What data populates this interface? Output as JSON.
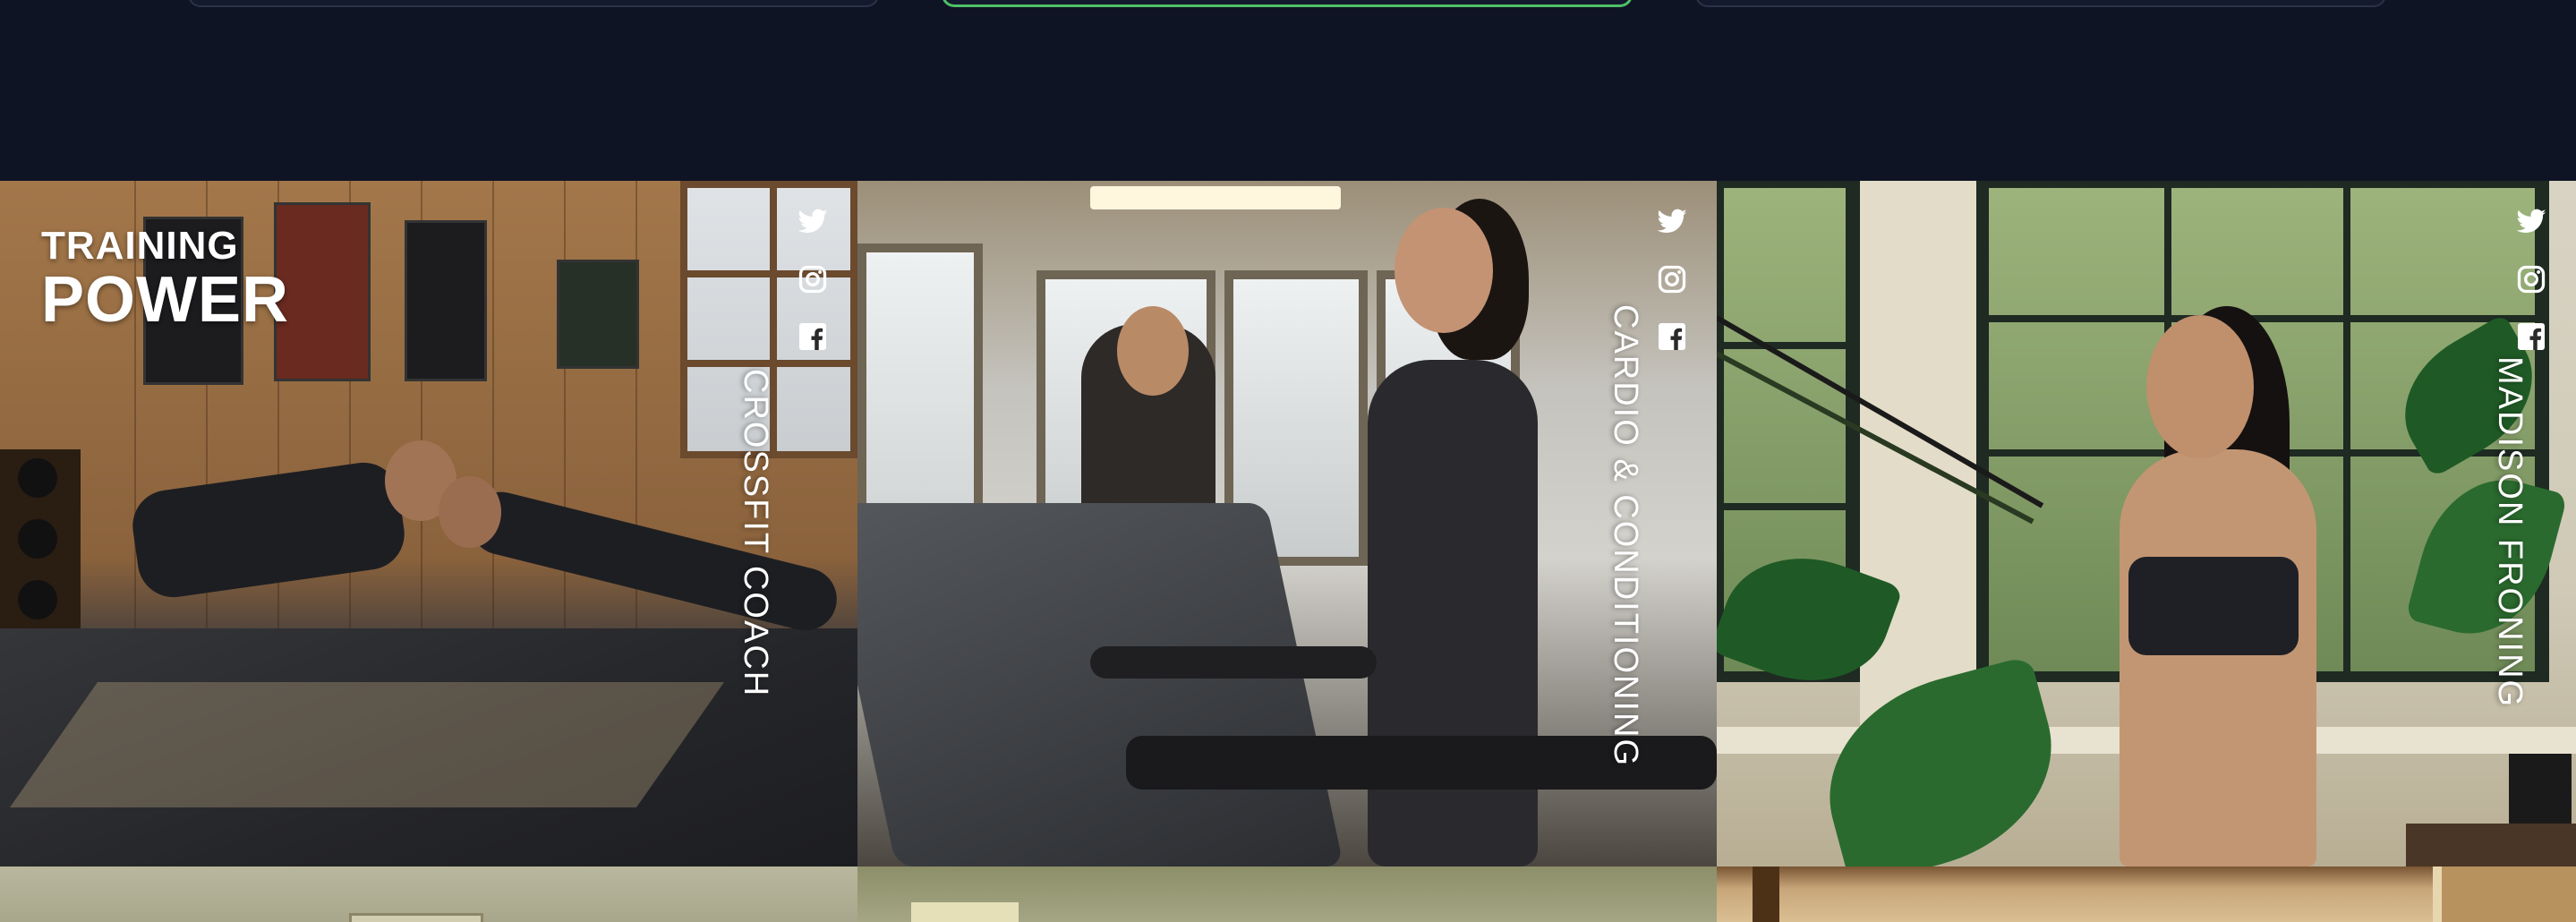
{
  "brand": {
    "line1": "TRAINING",
    "line2": "POWER"
  },
  "colors": {
    "page_background": "#0f1425",
    "highlight_border": "#4fbf67",
    "card_border": "#2c3348",
    "overlay_text": "#ffffff"
  },
  "team": [
    {
      "role": "CROSSFIT COACH",
      "social_icons": [
        "twitter-icon",
        "instagram-icon",
        "facebook-icon"
      ]
    },
    {
      "role": "CARDIO & CONDITIONING",
      "social_icons": [
        "twitter-icon",
        "instagram-icon",
        "facebook-icon"
      ]
    },
    {
      "role": "MADISON FRONING",
      "social_icons": [
        "twitter-icon",
        "instagram-icon",
        "facebook-icon"
      ]
    }
  ]
}
